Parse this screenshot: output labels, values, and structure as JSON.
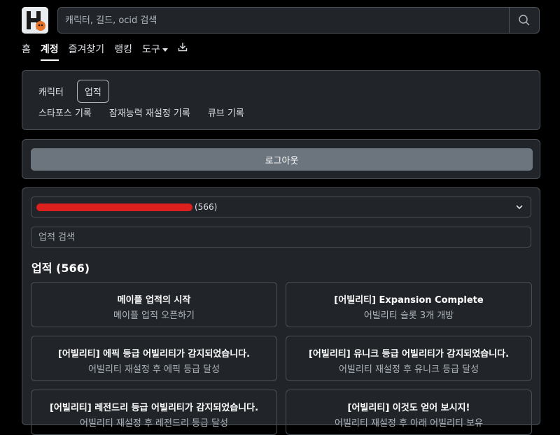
{
  "search": {
    "placeholder": "캐릭터, 길드, ocid 검색"
  },
  "nav": {
    "home": "홈",
    "account": "계정",
    "favorites": "즐겨찾기",
    "ranking": "랭킹",
    "tools": "도구"
  },
  "subtabs": {
    "character": "캐릭터",
    "achievement": "업적",
    "starforce": "스타포스 기록",
    "potential": "잠재능력 재설정 기록",
    "cube": "큐브 기록"
  },
  "logout": {
    "label": "로그아웃"
  },
  "account_select": {
    "count": "(566)"
  },
  "achievement_search": {
    "placeholder": "업적 검색"
  },
  "achievements": {
    "title": "업적 (566)",
    "items": [
      {
        "title": "메이플 업적의 시작",
        "desc": "메이플 업적 오픈하기"
      },
      {
        "title": "[어빌리티] Expansion Complete",
        "desc": "어빌리티 슬롯 3개 개방"
      },
      {
        "title": "[어빌리티] 에픽 등급 어빌리티가 감지되었습니다.",
        "desc": "어빌리티 재설정 후 에픽 등급 달성"
      },
      {
        "title": "[어빌리티] 유니크 등급 어빌리티가 감지되었습니다.",
        "desc": "어빌리티 재설정 후 유니크 등급 달성"
      },
      {
        "title": "[어빌리티] 레전드리 등급 어빌리티가 감지되었습니다.",
        "desc": "어빌리티 재설정 후 레전드리 등급 달성"
      },
      {
        "title": "[어빌리티] 이것도 얻어 보시지!",
        "desc": "어빌리티 재설정 후 아래 어빌리티 보유"
      }
    ]
  },
  "colors": {
    "background": "#000000",
    "card": "#212529",
    "border": "#495057",
    "logout_button": "#6c757d",
    "bar": "#dc2020"
  },
  "icons": {
    "logo": "maple-logo",
    "search": "search-icon",
    "tools_caret": "caret-down-icon",
    "download": "download-icon",
    "select_chevron": "chevron-down-icon"
  }
}
